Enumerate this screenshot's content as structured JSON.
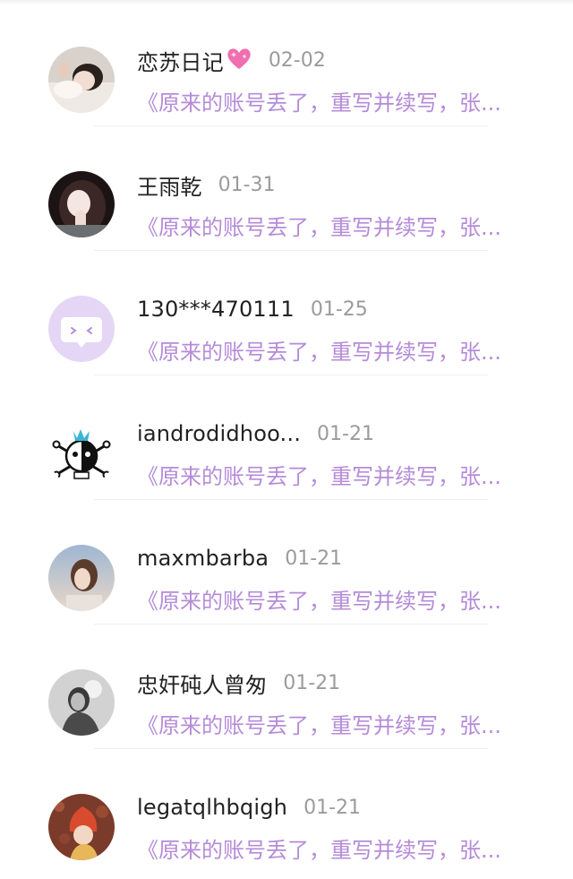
{
  "comments": [
    {
      "name": "恋苏日记",
      "date": "02-02",
      "snippet": "《原来的账号丢了，重写并续写，张...",
      "avatar": "photo-girl-lying"
    },
    {
      "name": "王雨乾",
      "date": "01-31",
      "snippet": "《原来的账号丢了，重写并续写，张...",
      "avatar": "photo-girl-hand"
    },
    {
      "name": "130***470111",
      "date": "01-25",
      "snippet": "《原来的账号丢了，重写并续写，张...",
      "avatar": "default-chat-bubble-icon"
    },
    {
      "name": "iandrodidhoo...",
      "date": "01-21",
      "snippet": "《原来的账号丢了，重写并续写，张...",
      "avatar": "skull-crossbones-icon"
    },
    {
      "name": "maxmbarba",
      "date": "01-21",
      "snippet": "《原来的账号丢了，重写并续写，张...",
      "avatar": "photo-woman-sky"
    },
    {
      "name": "忠奸砘人曾匆",
      "date": "01-21",
      "snippet": "《原来的账号丢了，重写并续写，张...",
      "avatar": "photo-bw-portrait"
    },
    {
      "name": "legatqlhbqigh",
      "date": "01-21",
      "snippet": "《原来的账号丢了，重写并续写，张...",
      "avatar": "photo-child-leaves"
    }
  ],
  "colors": {
    "name": "#222222",
    "date": "#9b9b9b",
    "snippet": "#b58bd9",
    "default_avatar_bg": "#e5d6f6"
  },
  "icons": {
    "heart": "sparkling-heart-icon"
  }
}
